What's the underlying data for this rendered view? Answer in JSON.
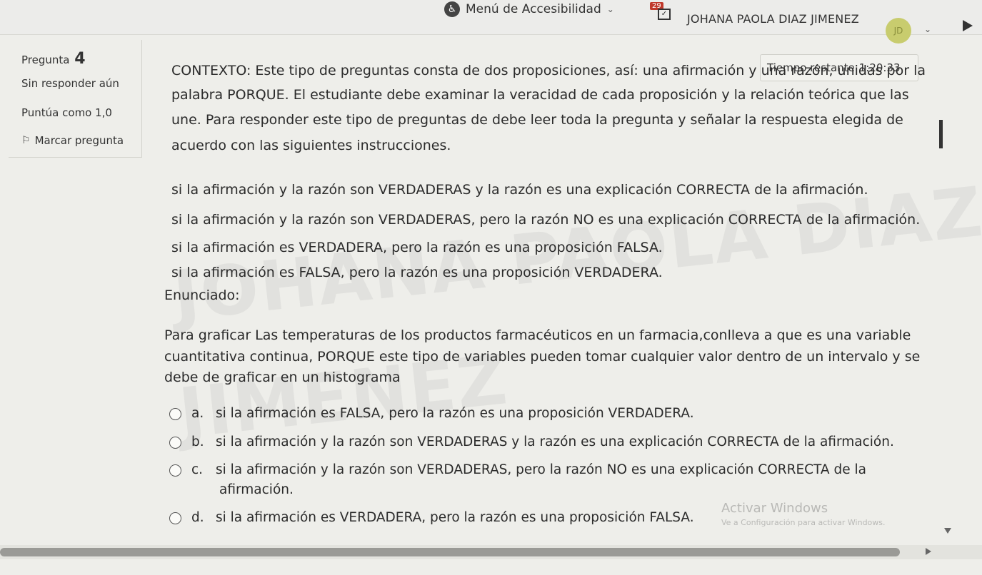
{
  "header": {
    "accessibility_menu": "Menú de Accesibilidad",
    "notification_count": "29",
    "user_name": "JOHANA PAOLA DIAZ JIMENEZ",
    "avatar_initials": "JD"
  },
  "question_info": {
    "label": "Pregunta",
    "number": "4",
    "status": "Sin responder aún",
    "grade": "Puntúa como 1,0",
    "flag_label": "Marcar pregunta"
  },
  "timer": {
    "label": "Tiempo restante",
    "value": "1:20:33"
  },
  "question": {
    "context_lines": [
      "CONTEXTO: Este tipo de preguntas consta de dos proposiciones, así: una afirmación y una razón, unidas por la",
      "palabra PORQUE. El estudiante debe examinar la veracidad de cada proposición y la relación teórica que las",
      "une. Para responder este tipo de preguntas de debe leer toda la pregunta y señalar la respuesta elegida de",
      "acuerdo con las siguientes instrucciones."
    ],
    "instructions": [
      "si la afirmación y la razón son VERDADERAS y la razón es una explicación CORRECTA de la afirmación.",
      "si la afirmación y la razón son VERDADERAS, pero la razón NO es una explicación CORRECTA de la afirmación.",
      "si la afirmación es VERDADERA, pero la razón es una proposición FALSA.",
      "si la afirmación es FALSA, pero la razón es una proposición VERDADERA."
    ],
    "enunciado_label": "Enunciado:",
    "enunciado_lines": [
      "Para graficar Las temperaturas de los productos farmacéuticos en un farmacia,conlleva a que es una variable",
      "cuantitativa continua, PORQUE este tipo de variables pueden tomar cualquier valor dentro de un intervalo y se",
      "debe de graficar en un histograma"
    ]
  },
  "options": [
    {
      "letter": "a.",
      "text": "si la afirmación es FALSA, pero la razón es una proposición VERDADERA.",
      "cont": ""
    },
    {
      "letter": "b.",
      "text": "si la afirmación y la razón son VERDADERAS y la razón es una explicación CORRECTA de la afirmación.",
      "cont": ""
    },
    {
      "letter": "c.",
      "text": "si la afirmación y la razón son VERDADERAS, pero la razón NO es una explicación CORRECTA de la",
      "cont": "afirmación."
    },
    {
      "letter": "d.",
      "text": "si la afirmación es VERDADERA, pero la razón es una proposición FALSA.",
      "cont": ""
    }
  ],
  "watermark": {
    "line1": "JOHANA PAOLA DIAZ",
    "line2": "JIMENEZ"
  },
  "windows_activation": {
    "title": "Activar Windows",
    "subtitle": "Ve a Configuración para activar Windows."
  }
}
